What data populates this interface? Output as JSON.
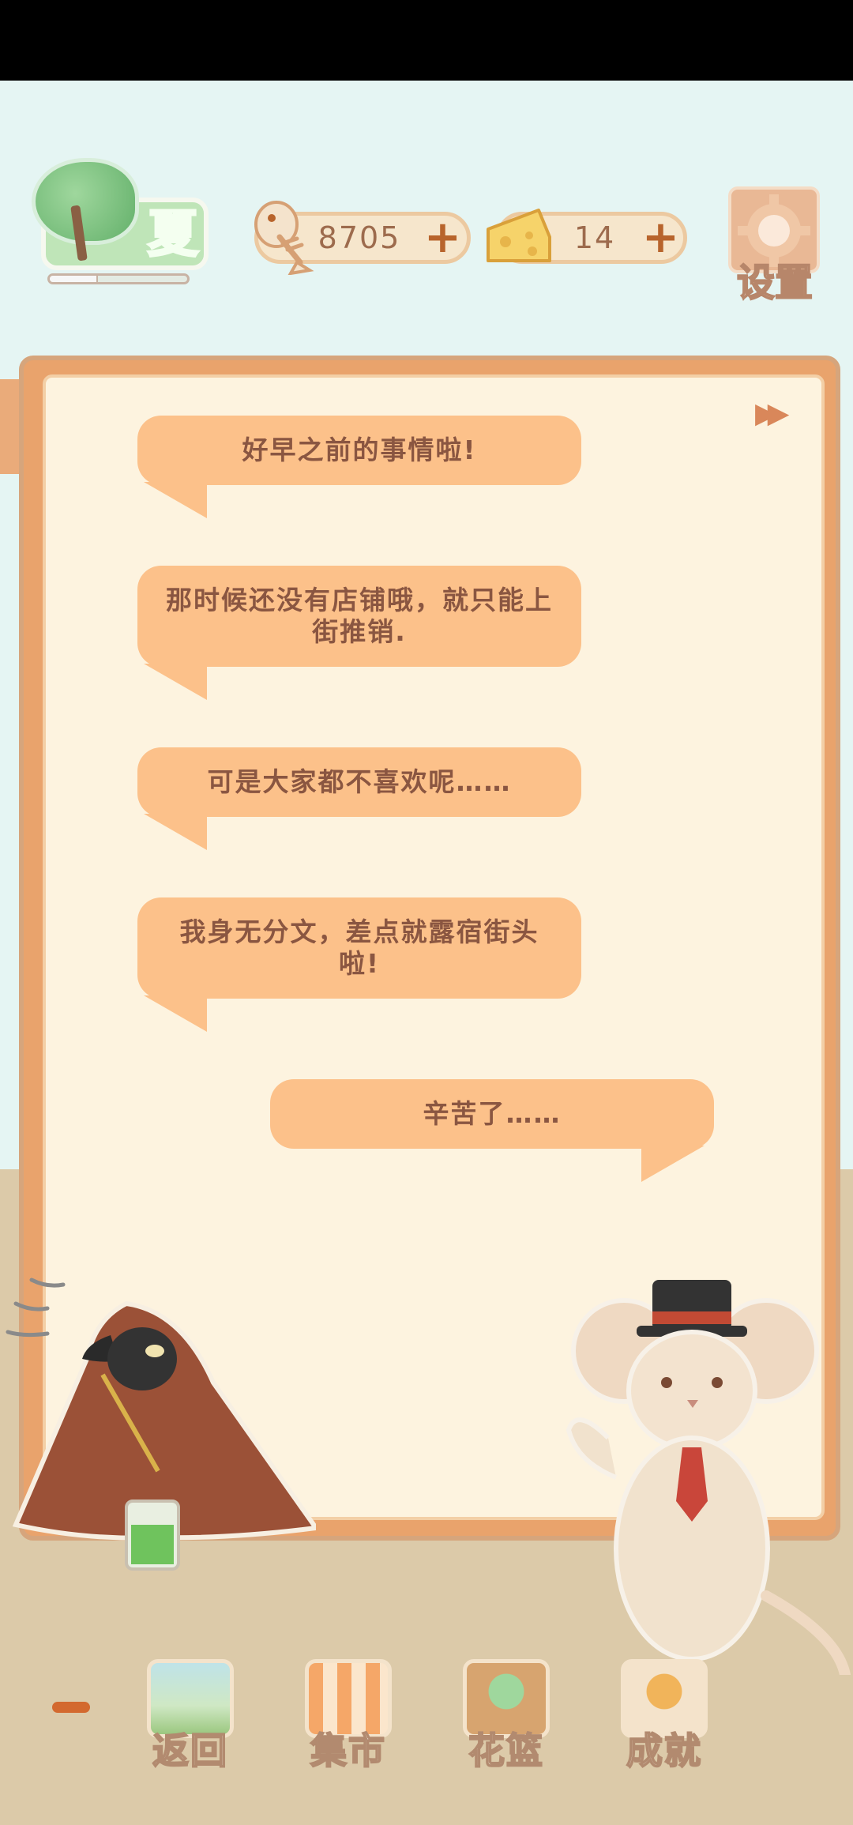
{
  "hud": {
    "season_label": "夏",
    "season_progress": 0.35,
    "fish_bones": "8705",
    "cheese": "14",
    "settings_label": "设置"
  },
  "dialogue": {
    "lines": [
      {
        "speaker": "left",
        "text": "好早之前的事情啦!"
      },
      {
        "speaker": "left",
        "text": "那时候还没有店铺哦，就只能上街推销."
      },
      {
        "speaker": "left",
        "text": "可是大家都不喜欢呢……"
      },
      {
        "speaker": "left",
        "text": "我身无分文，差点就露宿街头啦!"
      },
      {
        "speaker": "right",
        "text": "辛苦了……"
      }
    ]
  },
  "nav": {
    "back": "返回",
    "market": "集市",
    "basket": "花篮",
    "achievements": "成就"
  }
}
